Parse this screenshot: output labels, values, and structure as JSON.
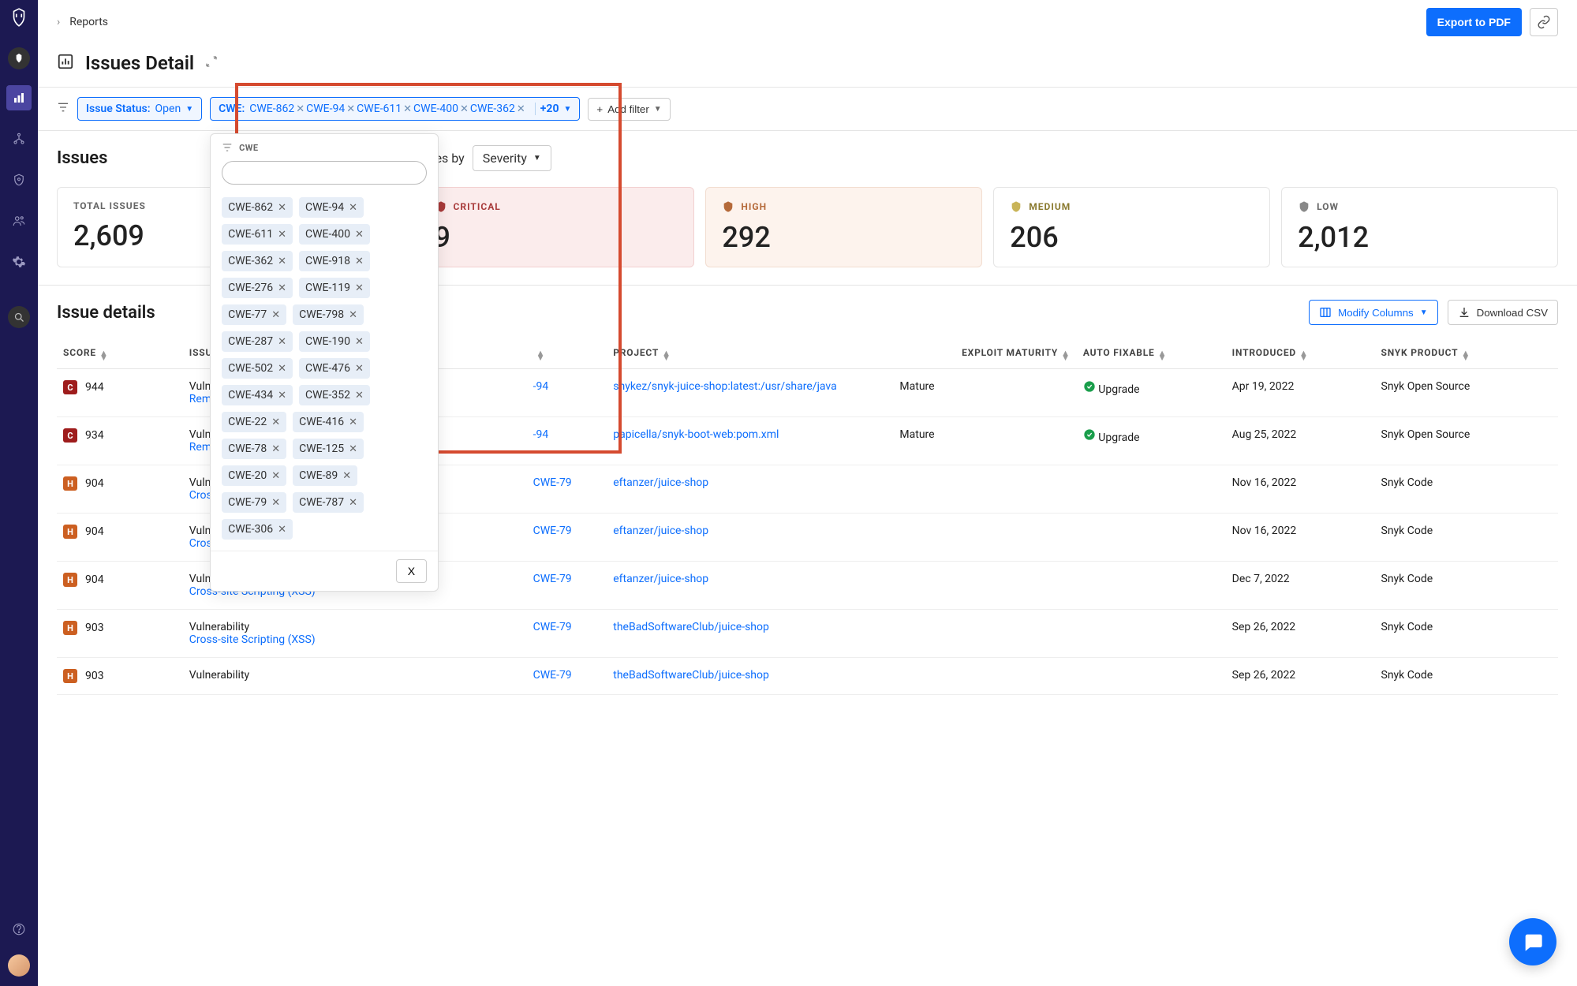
{
  "breadcrumb": {
    "reports": "Reports"
  },
  "topbar": {
    "export": "Export to PDF"
  },
  "page_title": "Issues Detail",
  "filters": {
    "status_label": "Issue Status:",
    "status_value": "Open",
    "cwe_label": "CWE:",
    "cwe_visible": [
      "CWE-862",
      "CWE-94",
      "CWE-611",
      "CWE-400",
      "CWE-362"
    ],
    "cwe_more": "+20",
    "add_filter": "Add filter"
  },
  "cwe_dropdown": {
    "title": "CWE",
    "tags": [
      "CWE-862",
      "CWE-94",
      "CWE-611",
      "CWE-400",
      "CWE-362",
      "CWE-918",
      "CWE-276",
      "CWE-119",
      "CWE-77",
      "CWE-798",
      "CWE-287",
      "CWE-190",
      "CWE-502",
      "CWE-476",
      "CWE-434",
      "CWE-352",
      "CWE-22",
      "CWE-416",
      "CWE-78",
      "CWE-125",
      "CWE-20",
      "CWE-89",
      "CWE-79",
      "CWE-787",
      "CWE-306"
    ],
    "close": "X"
  },
  "issues_heading": "Issues",
  "view_by_label": "View open issues by",
  "view_by_value": "Severity",
  "cards": {
    "total_label": "TOTAL ISSUES",
    "total_value": "2,609",
    "critical_label": "CRITICAL",
    "critical_value": "9",
    "high_label": "HIGH",
    "high_value": "292",
    "medium_label": "MEDIUM",
    "medium_value": "206",
    "low_label": "LOW",
    "low_value": "2,012"
  },
  "details_heading": "Issue details",
  "modify_columns": "Modify Columns",
  "download_csv": "Download CSV",
  "columns": {
    "score": "SCORE",
    "issue": "ISSUE",
    "cwe": "",
    "project": "PROJECT",
    "exploit": "EXPLOIT MATURITY",
    "autofix": "AUTO FIXABLE",
    "introduced": "INTRODUCED",
    "product": "SNYK PRODUCT"
  },
  "rows": [
    {
      "sev": "C",
      "score": "944",
      "issue_type": "Vulnerabili",
      "issue_name": "Remote C",
      "cwe": "-94",
      "project": "snykez/snyk-juice-shop:latest:/usr/share/java",
      "maturity": "Mature",
      "autofix": "Upgrade",
      "introduced": "Apr 19, 2022",
      "product": "Snyk Open Source"
    },
    {
      "sev": "C",
      "score": "934",
      "issue_type": "Vulnerabili",
      "issue_name": "Remote C",
      "cwe": "-94",
      "project": "papicella/snyk-boot-web:pom.xml",
      "maturity": "Mature",
      "autofix": "Upgrade",
      "introduced": "Aug 25, 2022",
      "product": "Snyk Open Source"
    },
    {
      "sev": "H",
      "score": "904",
      "issue_type": "Vulnerability",
      "issue_name": "Cross-site Scripting (XSS)",
      "cwe": "CWE-79",
      "project": "eftanzer/juice-shop",
      "maturity": "",
      "autofix": "",
      "introduced": "Nov 16, 2022",
      "product": "Snyk Code"
    },
    {
      "sev": "H",
      "score": "904",
      "issue_type": "Vulnerability",
      "issue_name": "Cross-site Scripting (XSS)",
      "cwe": "CWE-79",
      "project": "eftanzer/juice-shop",
      "maturity": "",
      "autofix": "",
      "introduced": "Nov 16, 2022",
      "product": "Snyk Code"
    },
    {
      "sev": "H",
      "score": "904",
      "issue_type": "Vulnerability",
      "issue_name": "Cross-site Scripting (XSS)",
      "cwe": "CWE-79",
      "project": "eftanzer/juice-shop",
      "maturity": "",
      "autofix": "",
      "introduced": "Dec 7, 2022",
      "product": "Snyk Code"
    },
    {
      "sev": "H",
      "score": "903",
      "issue_type": "Vulnerability",
      "issue_name": "Cross-site Scripting (XSS)",
      "cwe": "CWE-79",
      "project": "theBadSoftwareClub/juice-shop",
      "maturity": "",
      "autofix": "",
      "introduced": "Sep 26, 2022",
      "product": "Snyk Code"
    },
    {
      "sev": "H",
      "score": "903",
      "issue_type": "Vulnerability",
      "issue_name": "",
      "cwe": "CWE-79",
      "project": "theBadSoftwareClub/juice-shop",
      "maturity": "",
      "autofix": "",
      "introduced": "Sep 26, 2022",
      "product": "Snyk Code"
    }
  ]
}
